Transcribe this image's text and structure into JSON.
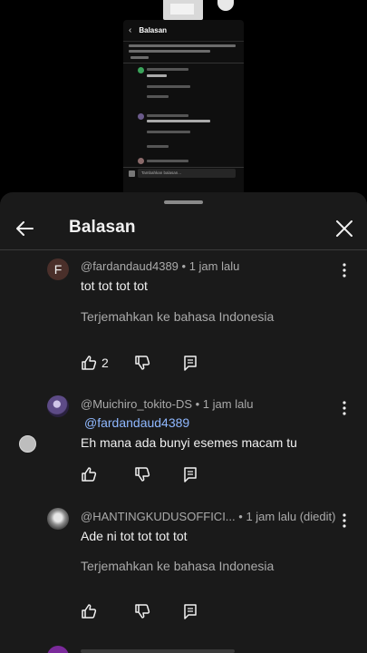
{
  "background": {
    "mini_title": "Balasan",
    "mini_placeholder": "Tambahkan balasan..."
  },
  "sheet": {
    "title": "Balasan"
  },
  "comments": [
    {
      "author": "@fardandaud4389",
      "time": "• 1 jam lalu",
      "avatar_letter": "F",
      "avatar_color": "#4a2f2a",
      "text": "tot  tot  tot  tot",
      "translate": "Terjemahkan ke bahasa Indonesia",
      "likes": "2"
    },
    {
      "author": "@Muichiro_tokito-DS",
      "time": "• 1 jam lalu",
      "mention": "@fardandaud4389",
      "text": "Eh mana ada bunyi esemes macam tu"
    },
    {
      "author": "@HANTINGKUDUSOFFICI...",
      "time": "• 1 jam lalu (diedit)",
      "text": "Ade ni tot tot tot tot",
      "translate": "Terjemahkan ke bahasa Indonesia"
    }
  ],
  "colors": {
    "sheet_bg": "#1a1a1a",
    "text_primary": "#f1f1f1",
    "text_secondary": "#aaaaaa",
    "mention": "#8fb8ff"
  }
}
